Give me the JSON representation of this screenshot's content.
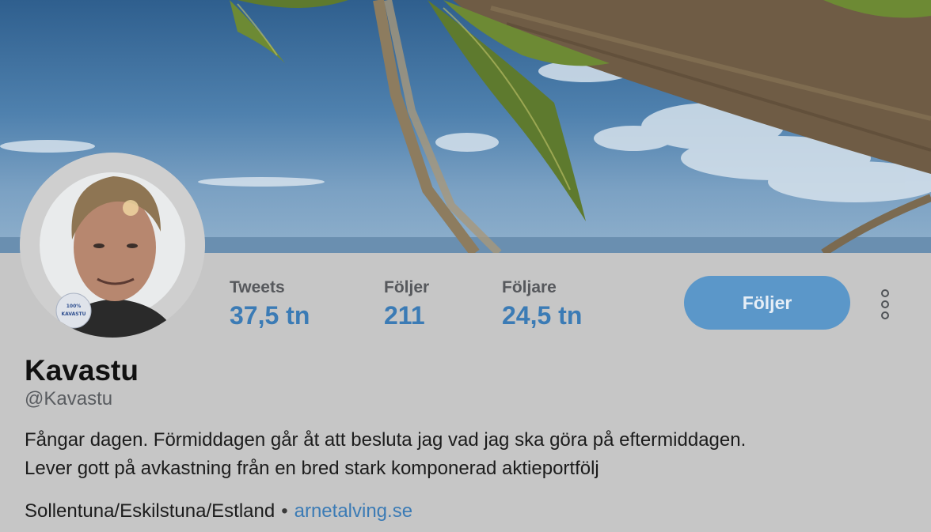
{
  "profile": {
    "display_name": "Kavastu",
    "handle": "@Kavastu",
    "bio_line1": "Fångar dagen. Förmiddagen går åt att besluta jag vad jag ska göra på eftermiddagen.",
    "bio_line2": "Lever gott på avkastning från en bred stark komponerad aktieportfölj",
    "location": "Sollentuna/Eskilstuna/Estland",
    "separator": "•",
    "website": "arnetalving.se",
    "avatar_badge_line1": "100%",
    "avatar_badge_line2": "KAVASTU"
  },
  "stats": [
    {
      "label": "Tweets",
      "value": "37,5 tn"
    },
    {
      "label": "Följer",
      "value": "211"
    },
    {
      "label": "Följare",
      "value": "24,5 tn"
    }
  ],
  "actions": {
    "follow_label": "Följer",
    "more_icon": "more-vertical-icon"
  },
  "colors": {
    "accent": "#3b7bb5",
    "follow_button": "#5b97c9",
    "page_background": "#c6c6c6"
  }
}
